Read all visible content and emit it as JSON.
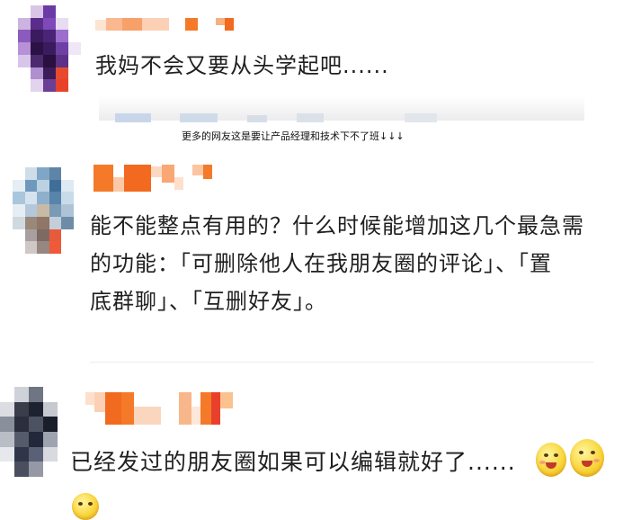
{
  "comments": [
    {
      "id": "c1",
      "text": "我妈不会又要从头学起吧......"
    },
    {
      "id": "c2",
      "text_lines": [
        "能不能整点有用的？什么时候能增加这几个最急需",
        "的功能：「可删除他人在我朋友圈的评论」、「置",
        "底群聊」、「互删好友」。"
      ]
    },
    {
      "id": "c3",
      "text": "已经发过的朋友圈如果可以编辑就好了......"
    }
  ],
  "caption": "更多的网友这是要让产品经理和技术下不了班↓↓↓",
  "emojis": [
    "laughing-face-icon",
    "laughing-face-icon",
    "smirk-face-icon"
  ],
  "colors": {
    "name_orange": "#f47a2a",
    "text": "#1f1f1f",
    "divider": "#ececec"
  }
}
